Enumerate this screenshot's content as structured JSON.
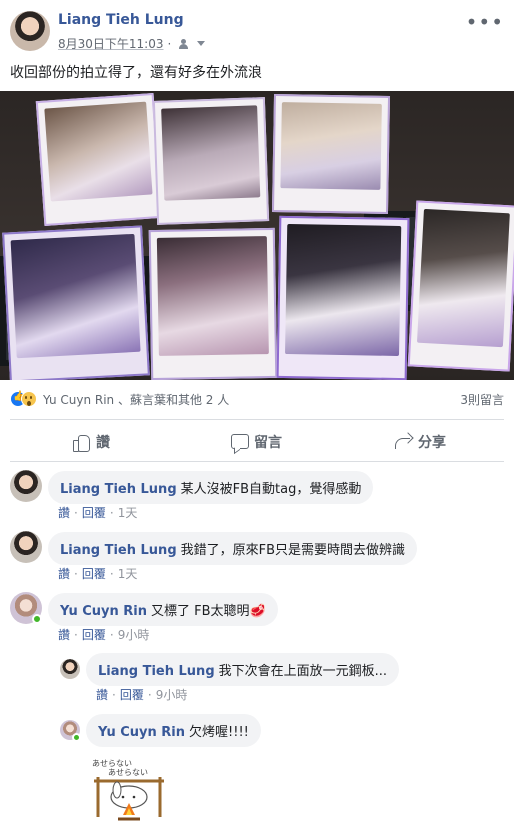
{
  "post": {
    "author": "Liang Tieh Lung",
    "timestamp": "8月30日下午11:03",
    "text": "收回部份的拍立得了，還有好多在外流浪",
    "more_icon": "ellipsis-icon",
    "audience_icon": "friends-icon"
  },
  "reactions": {
    "summary": "Yu Cuyn Rin 、蘇言葉和其他 2 人",
    "comment_count": "3則留言",
    "types": [
      "like",
      "wow"
    ]
  },
  "actions": {
    "like_label": "讚",
    "comment_label": "留言",
    "share_label": "分享"
  },
  "comments": [
    {
      "author": "Liang Tieh Lung",
      "text": "某人沒被FB自動tag，覺得感動",
      "like": "讚",
      "reply": "回覆",
      "time": "1天"
    },
    {
      "author": "Liang Tieh Lung",
      "text": "我錯了，原來FB只是需要時間去做辨識",
      "like": "讚",
      "reply": "回覆",
      "time": "1天"
    },
    {
      "author": "Yu Cuyn Rin",
      "text": "又標了 FB太聰明🥩",
      "like": "讚",
      "reply": "回覆",
      "time": "9小時"
    }
  ],
  "replies": [
    {
      "author": "Liang Tieh Lung",
      "text": "我下次會在上面放一元鋼板...",
      "like": "讚",
      "reply": "回覆",
      "time": "9小時"
    },
    {
      "author": "Yu Cuyn Rin",
      "text": "欠烤喔!!!!"
    }
  ],
  "sticker": {
    "line1": "あせらない",
    "line2": "あせらない"
  },
  "colors": {
    "link": "#385898",
    "bubble": "#f2f3f5",
    "meta": "#616770",
    "online": "#42b72a",
    "like_blue": "#1877f2"
  }
}
